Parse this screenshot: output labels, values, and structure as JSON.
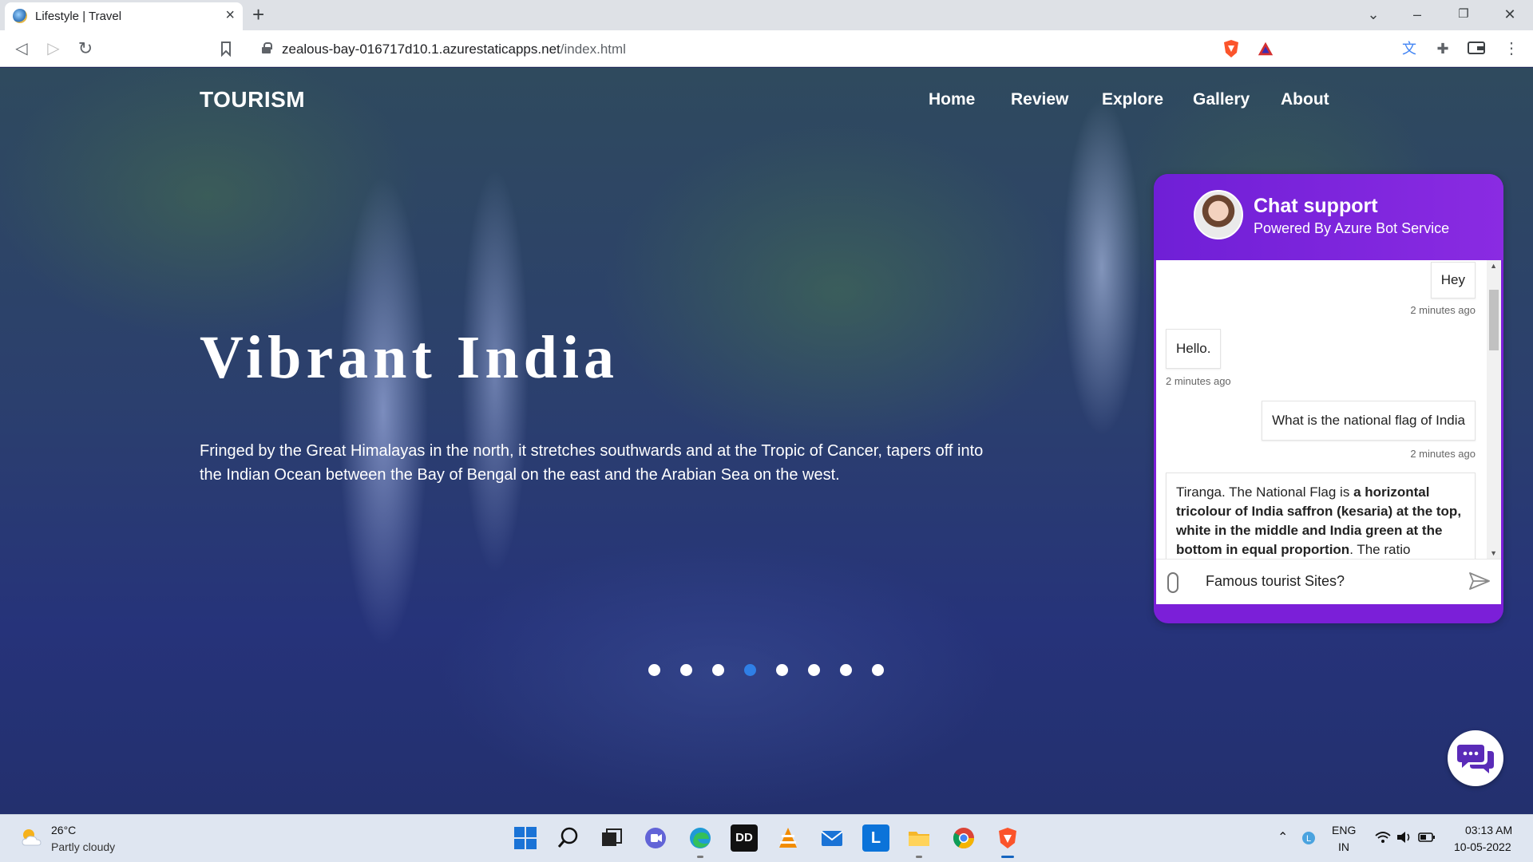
{
  "browser": {
    "tab_title": "Lifestyle | Travel",
    "new_tab": "+",
    "url_host": "zealous-bay-016717d10.1.azurestaticapps.net",
    "url_path": "/index.html",
    "window_controls": {
      "list": "⌄",
      "minimize": "–",
      "maximize": "❐",
      "close": "✕"
    }
  },
  "site": {
    "logo": "TOURISM",
    "nav": [
      "Home",
      "Review",
      "Explore",
      "Gallery",
      "About"
    ],
    "hero_title": "Vibrant India",
    "hero_text": "Fringed by the Great Himalayas in the north, it stretches southwards and at the Tropic of Cancer, tapers off into the Indian Ocean between the Bay of Bengal on the east and the Arabian Sea on the west.",
    "carousel": {
      "count": 8,
      "active_index": 3
    }
  },
  "chat": {
    "title": "Chat support",
    "subtitle": "Powered By Azure Bot Service",
    "messages": [
      {
        "from": "user",
        "text": "Hey",
        "time": "2 minutes ago"
      },
      {
        "from": "bot",
        "text": "Hello.",
        "time": "2 minutes ago"
      },
      {
        "from": "user",
        "text": "What is the national flag of India",
        "time": "2 minutes ago"
      },
      {
        "from": "bot",
        "text_plain_1": "Tiranga. The National Flag is ",
        "text_bold": "a horizontal tricolour of India saffron (kesaria) at the top, white in the middle and India green at the bottom in equal proportion",
        "text_plain_2": ". The ratio"
      }
    ],
    "input_value": "Famous tourist Sites?"
  },
  "taskbar": {
    "temperature": "26°C",
    "condition": "Partly cloudy",
    "apps": [
      "windows-start",
      "search",
      "task-view",
      "teams-chat",
      "edge",
      "dolby",
      "vlc",
      "mail",
      "l-app",
      "file-explorer",
      "chrome",
      "brave"
    ],
    "language": "ENG",
    "region": "IN",
    "time": "03:13 AM",
    "date": "10-05-2022"
  },
  "colors": {
    "chat_purple": "#7b1fd8",
    "active_dot": "#2f7fe6",
    "taskbar_bg": "#dfe6f1"
  }
}
